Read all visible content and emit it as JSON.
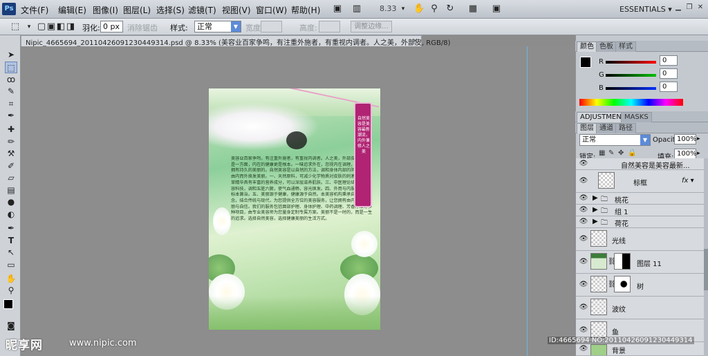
{
  "menubar": {
    "logo": "Ps",
    "items": [
      "文件(F)",
      "编辑(E)",
      "图像(I)",
      "图层(L)",
      "选择(S)",
      "滤镜(T)",
      "视图(V)",
      "窗口(W)",
      "帮助(H)"
    ],
    "zoom": "8.33",
    "workspace": "ESSENTIALS ▾"
  },
  "options": {
    "feather_label": "羽化:",
    "feather_value": "0 px",
    "antialias": "消除锯齿",
    "style_label": "样式:",
    "style_value": "正常",
    "width_label": "宽度:",
    "height_label": "高度:",
    "refine_btn": "调整边缘..."
  },
  "document": {
    "tab_title": "Nipic_4665694_20110426091230449314.psd @ 8.33% (美容业百家争鸣，有注重外施者，有重视内调者。人之美，外部皮, RGB/8)"
  },
  "poster": {
    "banner_text": "自然美容是美容最新潮流，内外兼修人之美",
    "body_text": "美容业百家争鸣，有注重外施者，有重视内调者。人之美，外部皮肤的美丽是一方面，内在的健康更是根本。一味追求外在，忽视内在调理，是不可能拥有持久的美丽的。自然美容是以自然的方法，调和身体内部的阴阳平衡，由内而外焕发美丽。一、天然原料，可减少化学物质对皮肤的刺激。二、花草精华具有丰富的营养成分，可以深层滋养肌肤。三、中医理论结合现代美容科技，调和五脏六腑，使气血通畅，容光焕发。四、外用与内服相结合，标本兼治。五、美丽源于健康，健康源于自然。本美容机构秉承自然美容理念，结合传统与现代，为您提供全方位的美容服务，让您拥有由内而外的美丽与自信。我们的服务包括面部护理、身体护理、中药调理、芳香疗法等多种项目，由专业美容师为您量身定制专属方案。美丽不是一时的，而是一生的追求。选择自然美容，选择健康美丽的生活方式。"
  },
  "color_panel": {
    "tabs": [
      "颜色",
      "色板",
      "样式"
    ],
    "channels": [
      {
        "label": "R",
        "value": "0",
        "color": "#c22020"
      },
      {
        "label": "G",
        "value": "0",
        "color": "#1f9b1f"
      },
      {
        "label": "B",
        "value": "0",
        "color": "#2038c2"
      }
    ]
  },
  "adj_tabs": [
    "ADJUSTMENTS",
    "MASKS"
  ],
  "layers_panel": {
    "tabs": [
      "图层",
      "通道",
      "路径"
    ],
    "blend_mode": "正常",
    "opacity_label": "Opacity:",
    "opacity_value": "100%",
    "lock_label": "锁定:",
    "fill_label": "填充:",
    "fill_value": "100%",
    "top_layer": "自然美容是美容最新...",
    "layers": [
      {
        "name": "标框",
        "type": "fx"
      },
      {
        "name": "桃花",
        "type": "group"
      },
      {
        "name": "组 1",
        "type": "group"
      },
      {
        "name": "荷花",
        "type": "group"
      },
      {
        "name": "光线",
        "type": "layer"
      },
      {
        "name": "图层 11",
        "type": "masked"
      },
      {
        "name": "树",
        "type": "masked"
      },
      {
        "name": "波纹",
        "type": "layer"
      },
      {
        "name": "鱼",
        "type": "layer"
      },
      {
        "name": "背景",
        "type": "layer"
      }
    ]
  },
  "watermark": {
    "logo": "昵享网",
    "url": "www.nipic.com",
    "id": "ID:4665694 NO:20110426091230449314"
  }
}
